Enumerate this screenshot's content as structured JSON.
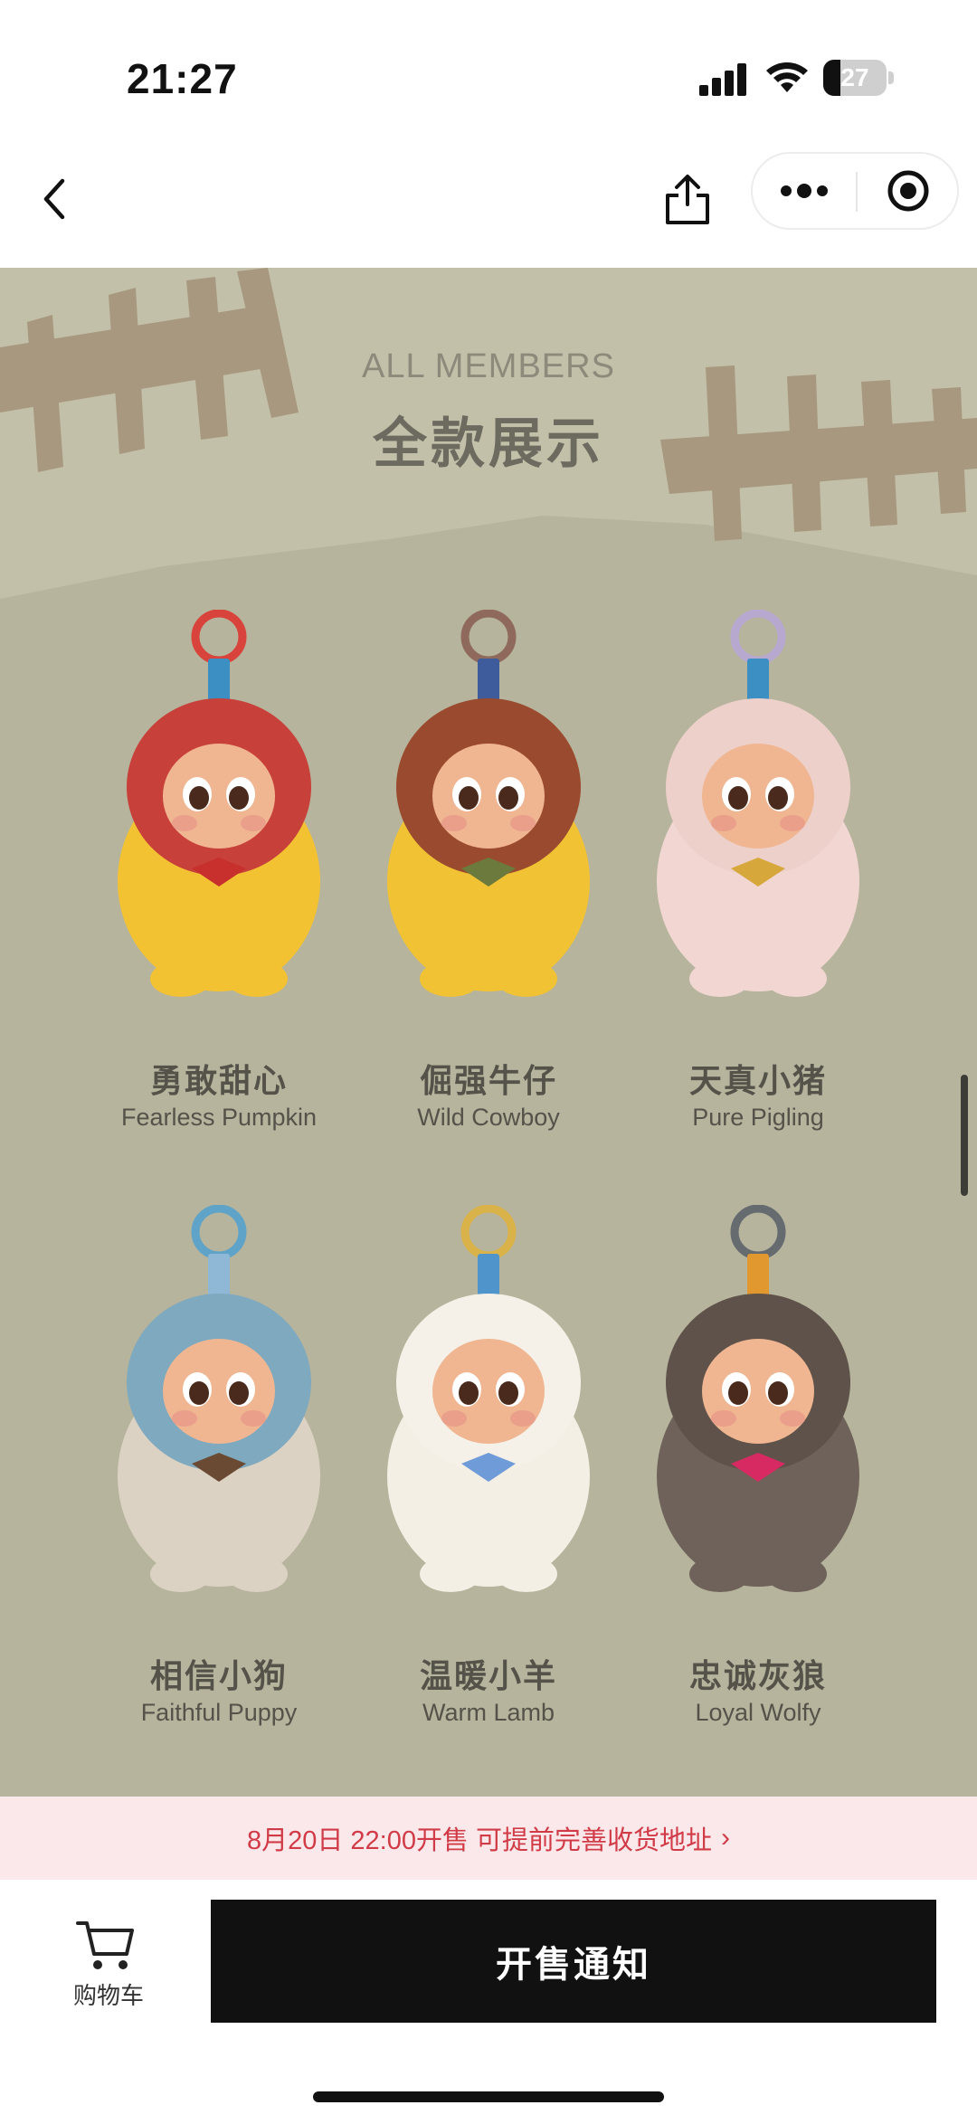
{
  "status_bar": {
    "time": "21:27",
    "battery_level": 27,
    "battery_text": "27"
  },
  "nav": {
    "back_icon": "chevron-left-icon",
    "share_icon": "share-icon",
    "more_icon": "more-dots-icon",
    "close_icon": "target-circle-icon"
  },
  "section": {
    "title_en": "ALL MEMBERS",
    "title_cn": "全款展示"
  },
  "members": [
    {
      "name_cn": "勇敢甜心",
      "name_en": "Fearless Pumpkin",
      "main": "#f3c233",
      "hood": "#c8403a",
      "ring": "#d8433b",
      "strap": "#3c8fc2",
      "face": "#f0b691",
      "accent": "#c7302c"
    },
    {
      "name_cn": "倔强牛仔",
      "name_en": "Wild Cowboy",
      "main": "#f1c234",
      "hood": "#9a4a2e",
      "ring": "#8f6a5c",
      "strap": "#3e5b9c",
      "face": "#f0b691",
      "accent": "#6d7a3e"
    },
    {
      "name_cn": "天真小猪",
      "name_en": "Pure Pigling",
      "main": "#f2d6d2",
      "hood": "#eed0cb",
      "ring": "#b7a8cf",
      "strap": "#3c8fc2",
      "face": "#f0b691",
      "accent": "#d6a83c"
    },
    {
      "name_cn": "相信小狗",
      "name_en": "Faithful Puppy",
      "main": "#dcd2c4",
      "hood": "#7fa9bf",
      "ring": "#5fa3c9",
      "strap": "#8fb7d6",
      "face": "#f0b691",
      "accent": "#6b4a33"
    },
    {
      "name_cn": "温暖小羊",
      "name_en": "Warm Lamb",
      "main": "#f3efe4",
      "hood": "#f5f1e8",
      "ring": "#d9b24a",
      "strap": "#4f95cc",
      "face": "#f0b691",
      "accent": "#6f9bd8"
    },
    {
      "name_cn": "忠诚灰狼",
      "name_en": "Loyal Wolfy",
      "main": "#6e625a",
      "hood": "#5e524a",
      "ring": "#666b70",
      "strap": "#e0982f",
      "face": "#f0b691",
      "accent": "#d82a62"
    }
  ],
  "notice": {
    "text": "8月20日 22:00开售 可提前完善收货地址",
    "arrow": "›"
  },
  "bottom_bar": {
    "cart_label": "购物车",
    "cart_icon": "cart-icon",
    "notify_label": "开售通知"
  }
}
